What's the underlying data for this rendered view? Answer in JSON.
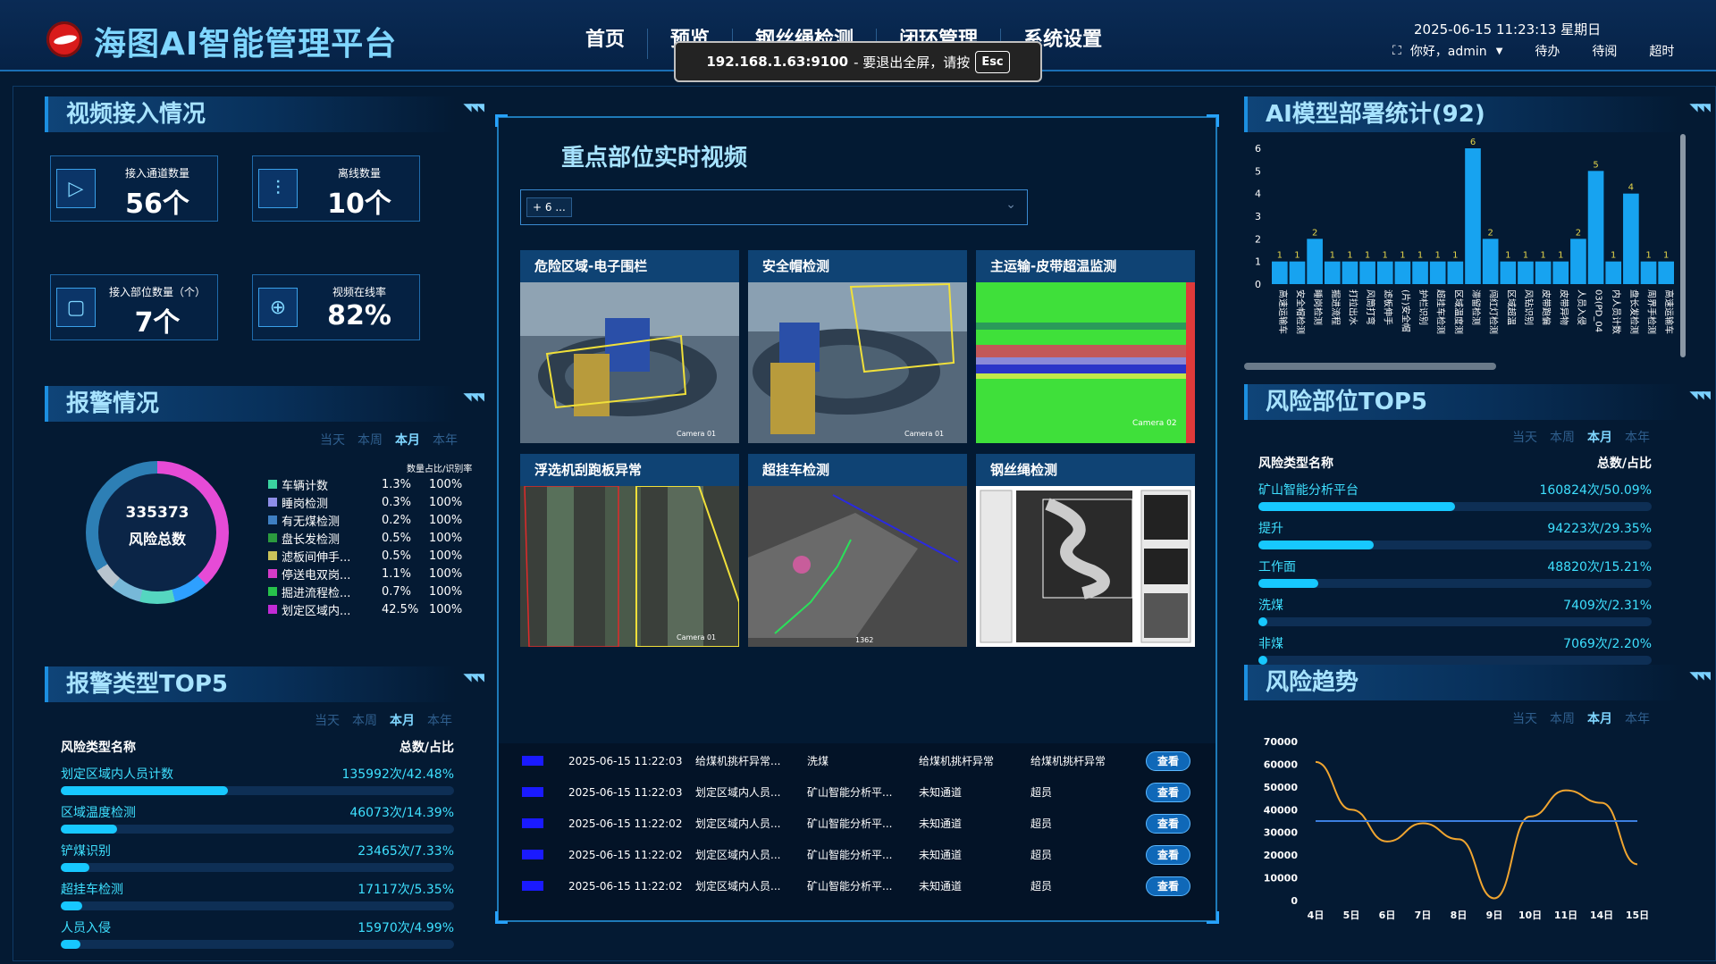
{
  "header": {
    "title": "海图AI智能管理平台",
    "nav": [
      "首页",
      "预览",
      "钢丝绳检测",
      "闭环管理",
      "系统设置"
    ],
    "datetime": "2025-06-15 11:23:13 星期日",
    "greeting": "你好，admin",
    "quick_links": [
      "待办",
      "待阅",
      "超时"
    ]
  },
  "fullscreen_toast": {
    "host": "192.168.1.63:9100",
    "message": "- 要退出全屏，请按",
    "key": "Esc"
  },
  "video_access": {
    "title": "视频接入情况",
    "stats": [
      {
        "label": "接入通道数量",
        "value": "56个",
        "icon": "screen-play-icon"
      },
      {
        "label": "离线数量",
        "value": "10个",
        "icon": "sliders-icon"
      },
      {
        "label": "接入部位数量（个）",
        "value": "7个",
        "icon": "square-nodes-icon"
      },
      {
        "label": "视频在线率",
        "value": "82%",
        "icon": "crosshair-icon"
      }
    ]
  },
  "alarm": {
    "title": "报警情况",
    "tabs": [
      "当天",
      "本周",
      "本月",
      "本年"
    ],
    "active_tab": "本月",
    "total_value": "335373",
    "total_label": "风险总数",
    "legend_header": "数量占比/识别率",
    "legend": [
      {
        "name": "车辆计数",
        "pct": "1.3%",
        "rate": "100%",
        "color": "#3ad29f"
      },
      {
        "name": "睡岗检测",
        "pct": "0.3%",
        "rate": "100%",
        "color": "#8e8ee8"
      },
      {
        "name": "有无煤检测",
        "pct": "0.2%",
        "rate": "100%",
        "color": "#3e7fc2"
      },
      {
        "name": "盘长发检测",
        "pct": "0.5%",
        "rate": "100%",
        "color": "#2b9a3e"
      },
      {
        "name": "滤板间伸手...",
        "pct": "0.5%",
        "rate": "100%",
        "color": "#c9c25a"
      },
      {
        "name": "停送电双岗...",
        "pct": "1.1%",
        "rate": "100%",
        "color": "#d63bc9"
      },
      {
        "name": "掘进流程检...",
        "pct": "0.7%",
        "rate": "100%",
        "color": "#27c24b"
      },
      {
        "name": "划定区域内...",
        "pct": "42.5%",
        "rate": "100%",
        "color": "#c22bd6"
      }
    ]
  },
  "alarm_top5": {
    "title": "报警类型TOP5",
    "tabs": [
      "当天",
      "本周",
      "本月",
      "本年"
    ],
    "active_tab": "本月",
    "col_name": "风险类型名称",
    "col_value": "总数/占比",
    "items": [
      {
        "name": "划定区域内人员计数",
        "value": "135992次/42.48%",
        "ratio": 0.4248
      },
      {
        "name": "区域温度检测",
        "value": "46073次/14.39%",
        "ratio": 0.1439
      },
      {
        "name": "铲煤识别",
        "value": "23465次/7.33%",
        "ratio": 0.0733
      },
      {
        "name": "超挂车检测",
        "value": "17117次/5.35%",
        "ratio": 0.0535
      },
      {
        "name": "人员入侵",
        "value": "15970次/4.99%",
        "ratio": 0.0499
      }
    ]
  },
  "center": {
    "title": "重点部位实时视频",
    "select_chip": "+ 6 ...",
    "cameras": [
      {
        "label": "危险区域-电子围栏",
        "overlay": "Camera 01"
      },
      {
        "label": "安全帽检测",
        "overlay": "Camera 01"
      },
      {
        "label": "主运输-皮带超温监测",
        "overlay": "Camera 02"
      },
      {
        "label": "浮选机刮跑板异常",
        "overlay": "Camera 01"
      },
      {
        "label": "超挂车检测",
        "overlay": "1362"
      },
      {
        "label": "钢丝绳检测",
        "overlay": ""
      }
    ],
    "alerts": [
      {
        "time": "2025-06-15 11:22:03",
        "type": "给煤机挑杆异常...",
        "site": "洗煤",
        "channel": "给煤机挑杆异常",
        "event": "给煤机挑杆异常",
        "action": "查看"
      },
      {
        "time": "2025-06-15 11:22:03",
        "type": "划定区域内人员...",
        "site": "矿山智能分析平...",
        "channel": "未知通道",
        "event": "超员",
        "action": "查看"
      },
      {
        "time": "2025-06-15 11:22:02",
        "type": "划定区域内人员...",
        "site": "矿山智能分析平...",
        "channel": "未知通道",
        "event": "超员",
        "action": "查看"
      },
      {
        "time": "2025-06-15 11:22:02",
        "type": "划定区域内人员...",
        "site": "矿山智能分析平...",
        "channel": "未知通道",
        "event": "超员",
        "action": "查看"
      },
      {
        "time": "2025-06-15 11:22:02",
        "type": "划定区域内人员...",
        "site": "矿山智能分析平...",
        "channel": "未知通道",
        "event": "超员",
        "action": "查看"
      }
    ]
  },
  "ai_models": {
    "title": "AI模型部署统计(92)",
    "chart_data": {
      "type": "bar",
      "ylim": [
        0,
        6
      ],
      "yticks": [
        0,
        1,
        2,
        3,
        4,
        5,
        6
      ],
      "categories": [
        "高速运输车",
        "安全帽检测",
        "睡岗检测",
        "掘进流程",
        "打拉出水",
        "风筒打弯",
        "滤板伸手",
        "(片)安全帽",
        "护栏识别",
        "超挂车检测",
        "区域温度测",
        "滞留检测",
        "闯红灯检测",
        "区域超温",
        "风钻识别",
        "皮带跑偏",
        "皮带异物",
        "人员入侵",
        "03(PD_04",
        "内人员计数",
        "盘长发检测",
        "周界手检测"
      ],
      "values": [
        1,
        1,
        2,
        1,
        1,
        1,
        1,
        1,
        1,
        1,
        1,
        6,
        2,
        1,
        1,
        1,
        1,
        2,
        5,
        1,
        4,
        1,
        1
      ],
      "bar_color": "#17a3f0",
      "label_color": "#e6d64a"
    }
  },
  "risk_top5": {
    "title": "风险部位TOP5",
    "tabs": [
      "当天",
      "本周",
      "本月",
      "本年"
    ],
    "active_tab": "本月",
    "col_name": "风险类型名称",
    "col_value": "总数/占比",
    "items": [
      {
        "name": "矿山智能分析平台",
        "value": "160824次/50.09%",
        "ratio": 0.5009
      },
      {
        "name": "提升",
        "value": "94223次/29.35%",
        "ratio": 0.2935
      },
      {
        "name": "工作面",
        "value": "48820次/15.21%",
        "ratio": 0.1521
      },
      {
        "name": "洗煤",
        "value": "7409次/2.31%",
        "ratio": 0.0231
      },
      {
        "name": "非煤",
        "value": "7069次/2.20%",
        "ratio": 0.022
      }
    ]
  },
  "risk_trend": {
    "title": "风险趋势",
    "tabs": [
      "当天",
      "本周",
      "本月",
      "本年"
    ],
    "active_tab": "本月",
    "chart_data": {
      "type": "line",
      "x": [
        "4日",
        "5日",
        "6日",
        "7日",
        "8日",
        "9日",
        "10日",
        "11日",
        "14日",
        "15日"
      ],
      "ylim": [
        0,
        70000
      ],
      "yticks": [
        0,
        10000,
        20000,
        30000,
        40000,
        50000,
        60000,
        70000
      ],
      "series": [
        {
          "values": [
            61000,
            40000,
            26000,
            34000,
            27000,
            1000,
            37000,
            48500,
            43000,
            16000
          ],
          "color": "#f0a530"
        },
        {
          "values": [
            35000,
            35000,
            35000,
            35000,
            35000,
            35000,
            35000,
            35000,
            35000,
            35000
          ],
          "color": "#3c7fe0"
        }
      ]
    }
  }
}
